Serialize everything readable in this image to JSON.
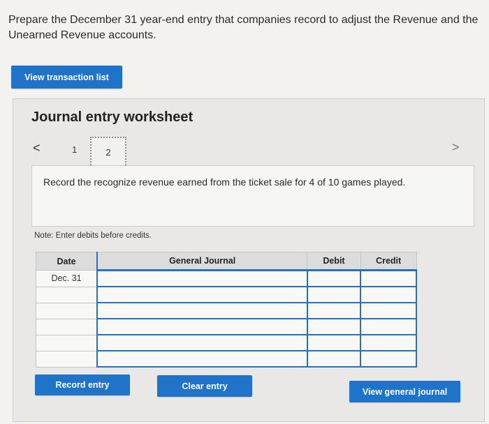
{
  "prompt": "Prepare the December 31 year-end entry that companies record to adjust the Revenue and the Unearned Revenue accounts.",
  "buttons": {
    "view_transaction_list": "View transaction list",
    "record_entry": "Record entry",
    "clear_entry": "Clear entry",
    "view_general_journal": "View general journal"
  },
  "worksheet": {
    "title": "Journal entry worksheet",
    "nav": {
      "prev": "<",
      "next": ">",
      "pages": [
        "1",
        "2"
      ],
      "current_page": "2"
    },
    "instruction": "Record the recognize revenue earned from the ticket sale for 4 of 10 games played.",
    "note": "Note: Enter debits before credits."
  },
  "table": {
    "headers": [
      "Date",
      "General Journal",
      "Debit",
      "Credit"
    ],
    "rows": [
      {
        "date": "Dec. 31",
        "account": "",
        "debit": "",
        "credit": ""
      },
      {
        "date": "",
        "account": "",
        "debit": "",
        "credit": ""
      },
      {
        "date": "",
        "account": "",
        "debit": "",
        "credit": ""
      },
      {
        "date": "",
        "account": "",
        "debit": "",
        "credit": ""
      },
      {
        "date": "",
        "account": "",
        "debit": "",
        "credit": ""
      },
      {
        "date": "",
        "account": "",
        "debit": "",
        "credit": ""
      }
    ]
  },
  "colors": {
    "button_blue": "#1f74c9",
    "input_border_blue": "#2870b8",
    "page_bg": "#f3f2ef",
    "worksheet_bg": "#e9e8e6"
  }
}
